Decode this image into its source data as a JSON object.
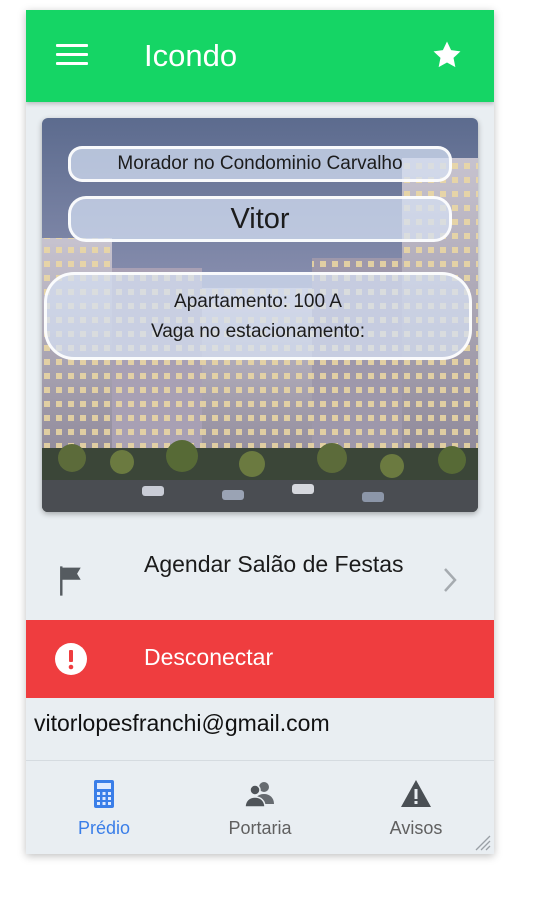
{
  "app": {
    "title": "Icondo"
  },
  "icons": {
    "menu": "menu-icon",
    "favorite": "star-icon",
    "flag": "flag-icon",
    "chevron": "chevron-right-icon",
    "alert": "alert-circle-icon",
    "calculator": "calculator-icon",
    "people": "people-icon",
    "warning": "warning-triangle-icon"
  },
  "colors": {
    "topbar": "#15d565",
    "danger": "#ef3d3f",
    "active_tab": "#3a7ee8",
    "background": "#e9eef2"
  },
  "profile_card": {
    "condo_label": "Morador no Condominio Carvalho",
    "resident_name": "Vitor",
    "apartment": "Apartamento: 100 A",
    "parking": "Vaga no estacionamento:"
  },
  "list": {
    "party_room": "Agendar Salão de Festas"
  },
  "logout": {
    "label": "Desconectar"
  },
  "account": {
    "email": "vitorlopesfranchi@gmail.com"
  },
  "tabs": [
    {
      "label": "Prédio",
      "active": true
    },
    {
      "label": "Portaria",
      "active": false
    },
    {
      "label": "Avisos",
      "active": false
    }
  ]
}
